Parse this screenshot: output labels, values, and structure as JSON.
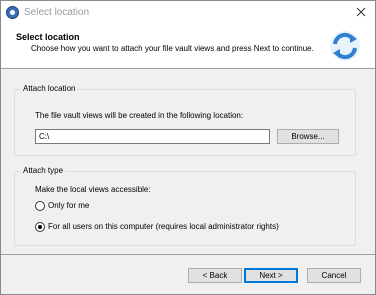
{
  "window": {
    "title": "Select location"
  },
  "header": {
    "title": "Select location",
    "subtitle": "Choose how you want to attach your file vault views and press Next to continue."
  },
  "attach_location": {
    "group_label": "Attach location",
    "description": "The file vault views will be created in the following location:",
    "path_value": "C:\\",
    "browse_label": "Browse..."
  },
  "attach_type": {
    "group_label": "Attach type",
    "description": "Make the local views accessible:",
    "options": [
      {
        "label": "Only for me",
        "selected": false
      },
      {
        "label": "For all users on this computer (requires local administrator rights)",
        "selected": true
      }
    ]
  },
  "footer": {
    "back_label": "< Back",
    "next_label": "Next >",
    "cancel_label": "Cancel"
  },
  "colors": {
    "accent": "#0078d7",
    "header_bg": "#ffffff",
    "body_bg": "#f0f0f0"
  },
  "icons": [
    "app-icon",
    "close-icon",
    "sync-arrows-icon"
  ]
}
